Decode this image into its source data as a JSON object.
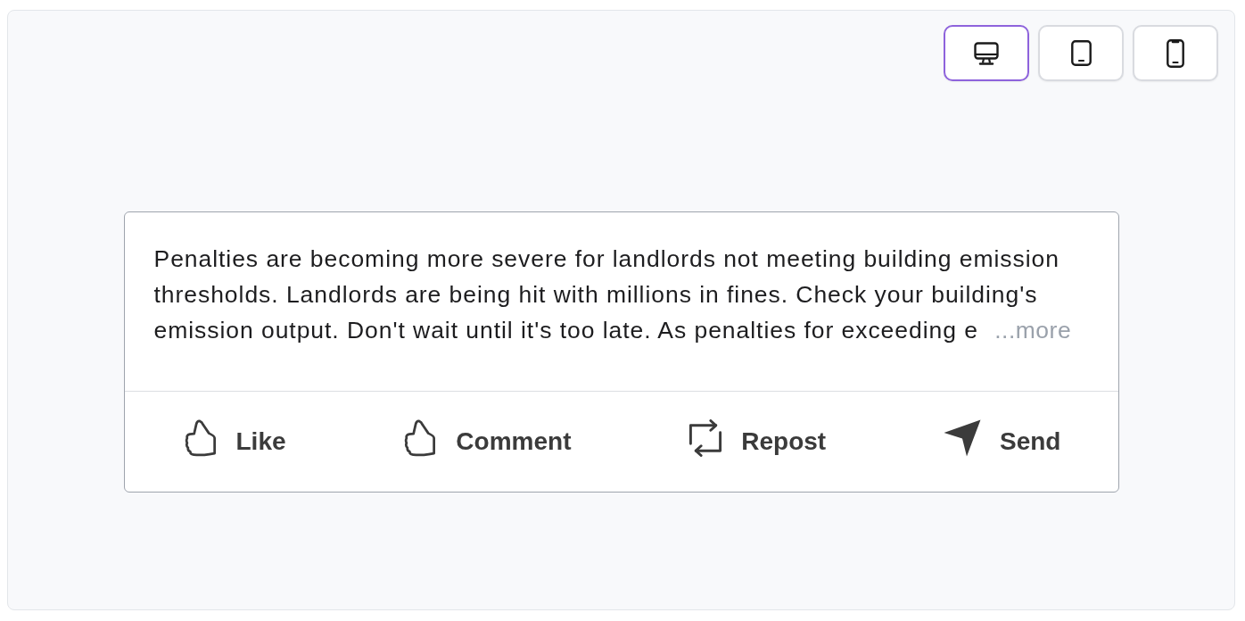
{
  "device_toggle": [
    {
      "kind": "desktop",
      "selected": true
    },
    {
      "kind": "tablet",
      "selected": false
    },
    {
      "kind": "phone",
      "selected": false
    }
  ],
  "post": {
    "text": "Penalties are becoming more severe for landlords not meeting building emission thresholds. Landlords are being hit with millions in fines. Check your building's emission output. Don't wait until it's too late. As penalties for exceeding e",
    "more_link": "...more"
  },
  "actions": [
    {
      "kind": "like",
      "label": "Like"
    },
    {
      "kind": "comment",
      "label": "Comment"
    },
    {
      "kind": "repost",
      "label": "Repost"
    },
    {
      "kind": "send",
      "label": "Send"
    }
  ]
}
